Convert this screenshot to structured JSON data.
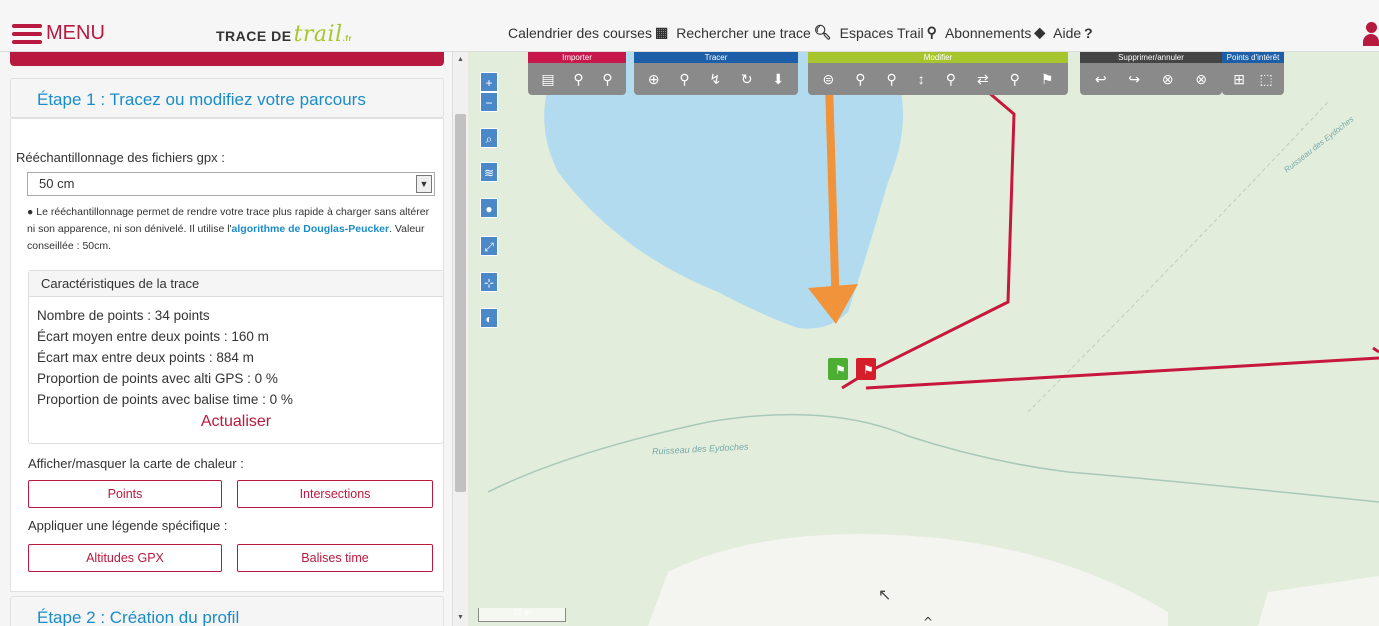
{
  "header": {
    "menu_label": "MENU",
    "logo_prefix": "TRACE DE",
    "logo_script": "trail",
    "logo_suffix": ".fr",
    "nav": [
      {
        "label": "Calendrier des courses",
        "icon": "calendar-icon"
      },
      {
        "label": "Rechercher une trace",
        "icon": "search-icon"
      },
      {
        "label": "Espaces Trail",
        "icon": "map-marker-icon"
      },
      {
        "label": "Abonnements",
        "icon": "tags-icon"
      },
      {
        "label": "Aide",
        "icon": "question-icon"
      }
    ]
  },
  "panel": {
    "step1_title": "Étape 1 : Tracez ou modifiez votre parcours",
    "resample_label": "Rééchantillonnage des fichiers gpx :",
    "resample_value": "50 cm",
    "hint_1": "Le rééchantillonnage permet de rendre votre trace plus rapide à charger sans altérer ni son apparence, ni son dénivelé. Il utilise l'",
    "hint_link": "algorithme de Douglas-Peucker",
    "hint_2": ". Valeur conseillée : 50cm.",
    "carac_title": "Caractéristiques de la trace",
    "stats": [
      "Nombre de points : 34 points",
      "Écart moyen entre deux points : 160 m",
      "Écart max entre deux points : 884 m",
      "Proportion de points avec alti GPS : 0 %",
      "Proportion de points avec balise time : 0 %"
    ],
    "refresh_label": "Actualiser",
    "heatmap_label": "Afficher/masquer la carte de chaleur :",
    "points_btn": "Points",
    "intersections_btn": "Intersections",
    "legend_label": "Appliquer une légende spécifique :",
    "altitudes_btn": "Altitudes GPX",
    "balises_btn": "Balises time",
    "step2_title": "Étape 2 : Création du profil"
  },
  "map": {
    "toolbar_groups": [
      {
        "label": "Importer",
        "color": "#c8174b"
      },
      {
        "label": "Tracer",
        "color": "#1d5ea8"
      },
      {
        "label": "Modifier",
        "color": "#a7c62e"
      },
      {
        "label": "Supprimer/annuler",
        "color": "#444444"
      },
      {
        "label": "Points d'intérêt",
        "color": "#1d5ea8"
      }
    ],
    "stream_label_1": "Ruisseau des Eydoches",
    "stream_label_2": "Ruisseau des Eydoches",
    "scale_label": "20 m",
    "zoom_in": "+",
    "zoom_out": "−"
  },
  "colors": {
    "brand": "#b8193e",
    "link": "#1a8cc8",
    "route": "#c8173d",
    "lake": "#b3dbf0",
    "arrow": "#f0933a"
  }
}
